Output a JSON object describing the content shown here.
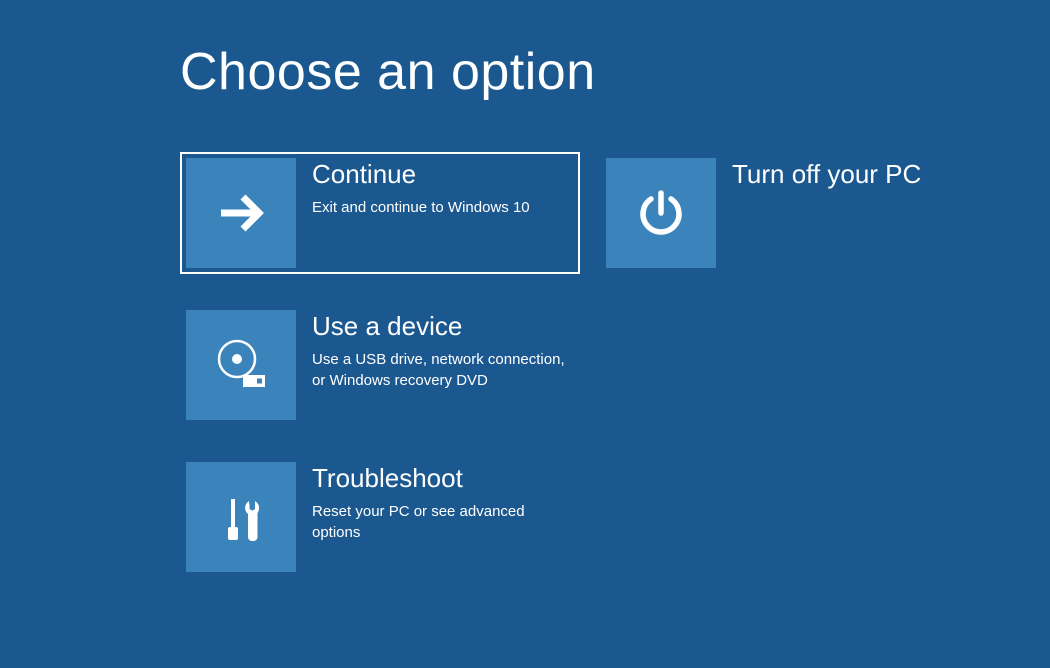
{
  "page": {
    "title": "Choose an option"
  },
  "options": {
    "continue": {
      "title": "Continue",
      "description": "Exit and continue to Windows 10"
    },
    "turnoff": {
      "title": "Turn off your PC",
      "description": ""
    },
    "usedevice": {
      "title": "Use a device",
      "description": "Use a USB drive, network connection, or Windows recovery DVD"
    },
    "troubleshoot": {
      "title": "Troubleshoot",
      "description": "Reset your PC or see advanced options"
    }
  },
  "colors": {
    "background": "#1a588f",
    "tile": "#3a83bb",
    "text": "#ffffff"
  }
}
